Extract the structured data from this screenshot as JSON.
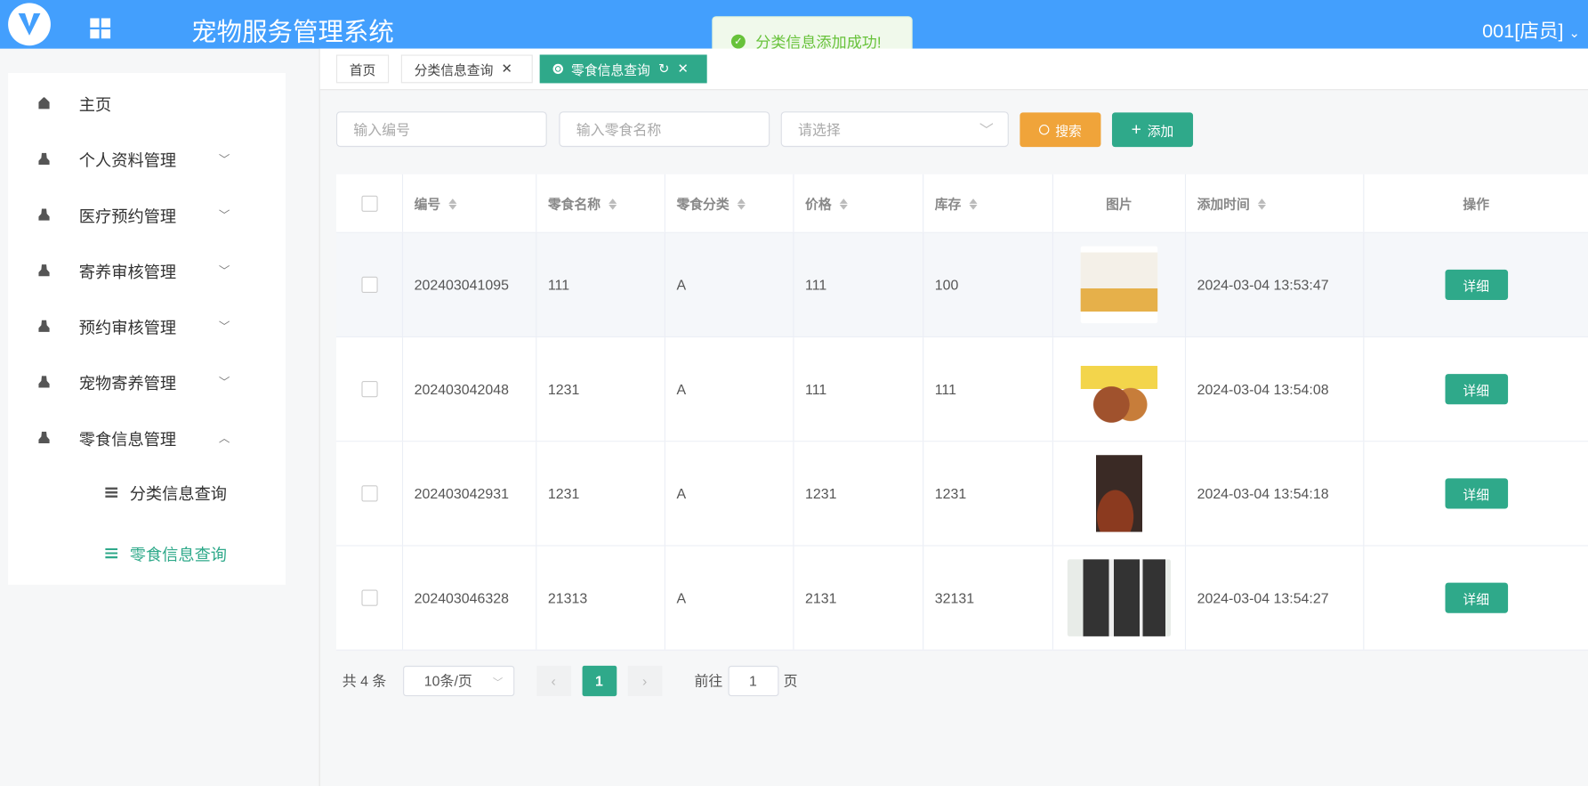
{
  "header": {
    "title": "宠物服务管理系统",
    "user": "001[店员]"
  },
  "toast": {
    "message": "分类信息添加成功!"
  },
  "sidebar": {
    "items": [
      {
        "label": "主页",
        "icon": "home-icon"
      },
      {
        "label": "个人资料管理",
        "icon": "user-icon"
      },
      {
        "label": "医疗预约管理",
        "icon": "user-icon"
      },
      {
        "label": "寄养审核管理",
        "icon": "user-icon"
      },
      {
        "label": "预约审核管理",
        "icon": "user-icon"
      },
      {
        "label": "宠物寄养管理",
        "icon": "user-icon"
      },
      {
        "label": "零食信息管理",
        "icon": "user-icon"
      }
    ],
    "subitems": [
      {
        "label": "分类信息查询"
      },
      {
        "label": "零食信息查询"
      }
    ]
  },
  "tabs": [
    {
      "label": "首页"
    },
    {
      "label": "分类信息查询"
    },
    {
      "label": "零食信息查询"
    }
  ],
  "filters": {
    "id_placeholder": "输入编号",
    "name_placeholder": "输入零食名称",
    "select_placeholder": "请选择",
    "search": "搜索",
    "add": "添加"
  },
  "table": {
    "columns": [
      "编号",
      "零食名称",
      "零食分类",
      "价格",
      "库存",
      "图片",
      "添加时间",
      "操作"
    ],
    "rows": [
      {
        "id": "202403041095",
        "name": "111",
        "category": "A",
        "price": "111",
        "stock": "100",
        "time": "2024-03-04 13:53:47",
        "action": "详细"
      },
      {
        "id": "202403042048",
        "name": "1231",
        "category": "A",
        "price": "111",
        "stock": "111",
        "time": "2024-03-04 13:54:08",
        "action": "详细"
      },
      {
        "id": "202403042931",
        "name": "1231",
        "category": "A",
        "price": "1231",
        "stock": "1231",
        "time": "2024-03-04 13:54:18",
        "action": "详细"
      },
      {
        "id": "202403046328",
        "name": "21313",
        "category": "A",
        "price": "2131",
        "stock": "32131",
        "time": "2024-03-04 13:54:27",
        "action": "详细"
      }
    ]
  },
  "pagination": {
    "total": "共 4 条",
    "page_size": "10条/页",
    "current": "1",
    "goto_label": "前往",
    "goto_value": "1",
    "page_suffix": "页"
  },
  "colors": {
    "header": "#439ffd",
    "primary": "#2fa98a",
    "warning": "#f0a43a"
  }
}
